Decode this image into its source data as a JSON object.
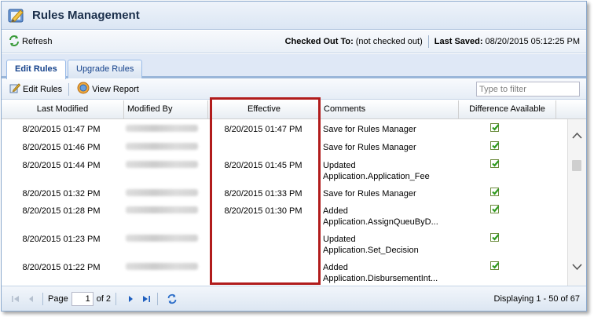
{
  "window": {
    "title": "Rules Management"
  },
  "infobar": {
    "refresh_label": "Refresh",
    "checked_out_label": "Checked Out To:",
    "checked_out_value": "(not checked out)",
    "last_saved_label": "Last Saved:",
    "last_saved_value": "08/20/2015 05:12:25 PM"
  },
  "tabs": [
    {
      "label": "Edit Rules",
      "active": true
    },
    {
      "label": "Upgrade Rules",
      "active": false
    }
  ],
  "toolbar": {
    "edit_rules_label": "Edit Rules",
    "view_report_label": "View Report",
    "filter_placeholder": "Type to filter"
  },
  "grid": {
    "columns": [
      "Last Modified",
      "Modified By",
      "Effective",
      "Comments",
      "Difference Available"
    ],
    "rows": [
      {
        "last_modified": "8/20/2015 01:47 PM",
        "effective": "8/20/2015 01:47 PM",
        "comment1": "Save for Rules Manager",
        "comment2": "",
        "difference": true
      },
      {
        "last_modified": "8/20/2015 01:46 PM",
        "effective": "",
        "comment1": "Save for Rules Manager",
        "comment2": "",
        "difference": true
      },
      {
        "last_modified": "8/20/2015 01:44 PM",
        "effective": "8/20/2015 01:45 PM",
        "comment1": "Updated",
        "comment2": "Application.Application_Fee",
        "difference": true
      },
      {
        "last_modified": "8/20/2015 01:32 PM",
        "effective": "8/20/2015 01:33 PM",
        "comment1": "Save for Rules Manager",
        "comment2": "",
        "difference": true
      },
      {
        "last_modified": "8/20/2015 01:28 PM",
        "effective": "8/20/2015 01:30 PM",
        "comment1": "Added",
        "comment2": "Application.AssignQueuByD...",
        "difference": true
      },
      {
        "last_modified": "8/20/2015 01:23 PM",
        "effective": "",
        "comment1": "Updated",
        "comment2": "Application.Set_Decision",
        "difference": true
      },
      {
        "last_modified": "8/20/2015 01:22 PM",
        "effective": "",
        "comment1": "Added",
        "comment2": "Application.DisbursementInt...",
        "difference": true
      }
    ]
  },
  "pager": {
    "page_label": "Page",
    "current_page": "1",
    "of_label": "of 2",
    "display_text": "Displaying 1 - 50 of 67"
  },
  "colors": {
    "accent": "#15428b",
    "highlight_box": "#b11c1c",
    "check": "#2e9a1e"
  }
}
